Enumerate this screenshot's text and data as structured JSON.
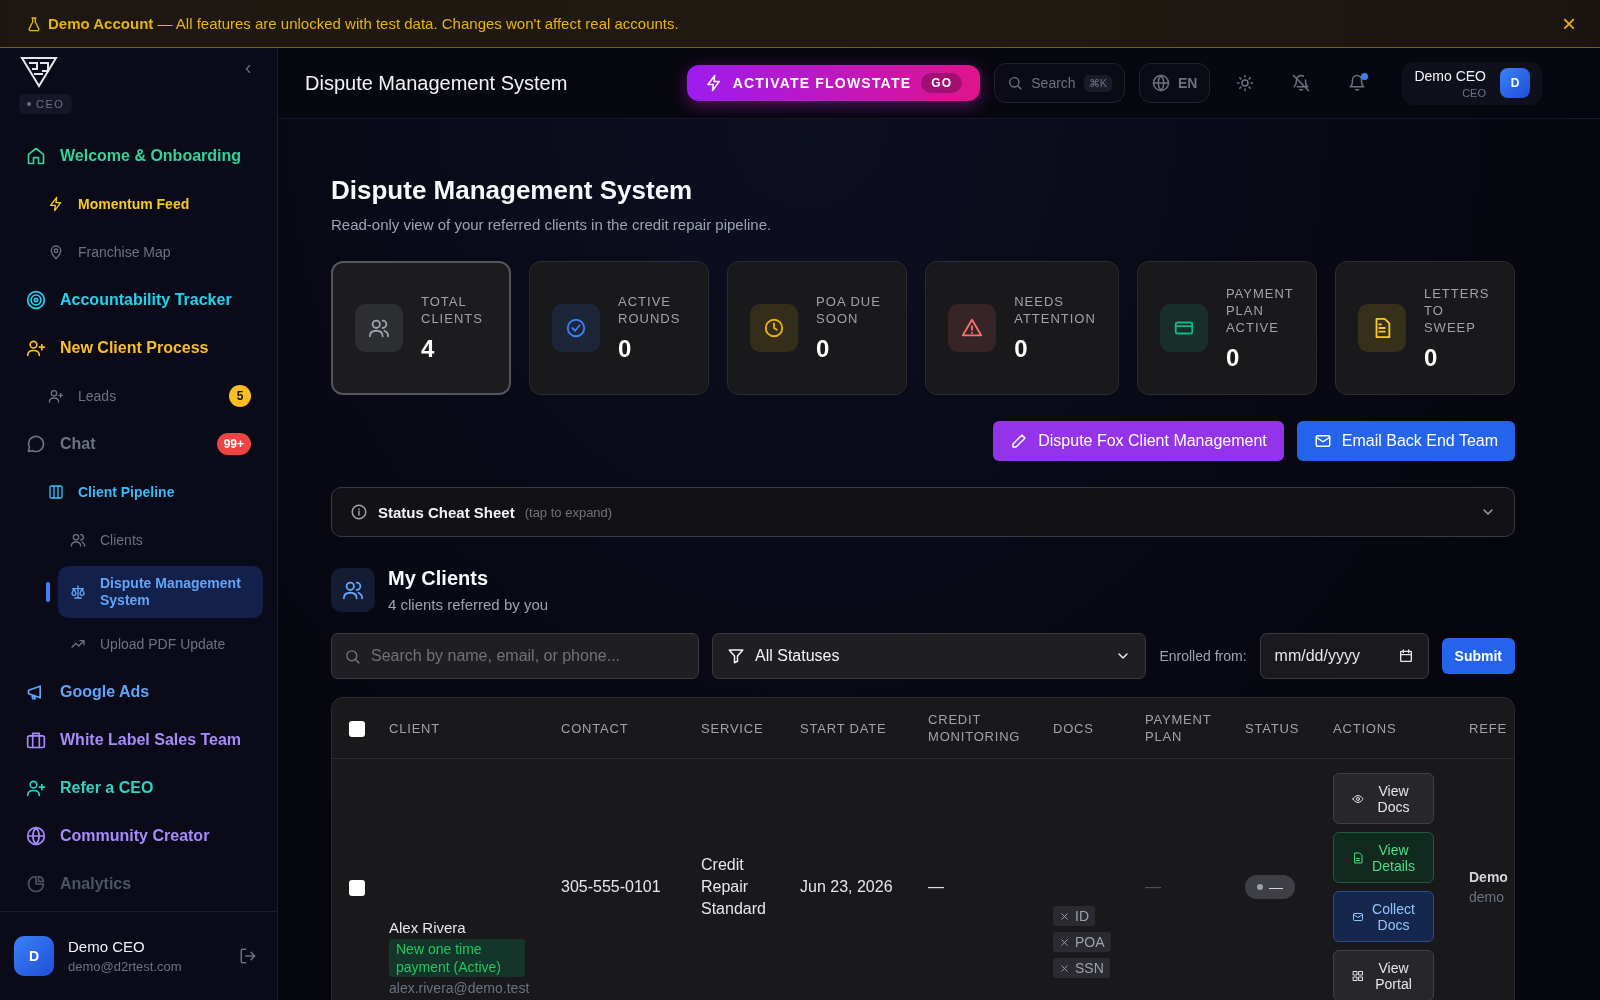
{
  "banner": {
    "text": "**Demo Account** — All features are unlocked with test data. Changes won't affect real accounts.",
    "close": "×"
  },
  "sidebar": {
    "role": "CEO",
    "items": [
      {
        "label": "Welcome & Onboarding",
        "color": "#34d399",
        "selected": false,
        "children": [
          {
            "label": "Momentum Feed",
            "color": "#facc15",
            "selected": false
          },
          {
            "label": "Franchise Map",
            "color": "#6b7280",
            "selected": false
          }
        ]
      },
      {
        "label": "Accountability Tracker",
        "color": "#22d3ee",
        "selected": false
      },
      {
        "label": "New Client Process",
        "color": "#fbbf24",
        "selected": false,
        "children": [
          {
            "label": "Leads",
            "color": "#6b7280",
            "selected": false,
            "badge": {
              "text": "5",
              "color": "#fbbf24"
            }
          }
        ]
      },
      {
        "label": "Chat",
        "color": "#6b7280",
        "selected": false,
        "badge": {
          "text": "99+",
          "color": "#ef4444"
        },
        "children": [
          {
            "label": "Client Pipeline",
            "color": "#38bdf8",
            "selected": false,
            "children": [
              {
                "label": "Clients",
                "color": "#6b7280",
                "selected": false
              },
              {
                "label": "Dispute Management System",
                "color": "#60a5fa",
                "selected": true
              },
              {
                "label": "Upload PDF Update",
                "color": "#6b7280",
                "selected": false
              }
            ]
          }
        ]
      },
      {
        "label": "Google Ads",
        "color": "#60a5fa",
        "selected": false
      },
      {
        "label": "White Label Sales Team",
        "color": "#a78bfa",
        "selected": false
      },
      {
        "label": "Refer a CEO",
        "color": "#2dd4bf",
        "selected": false
      },
      {
        "label": "Community Creator",
        "color": "#a78bfa",
        "selected": false
      },
      {
        "label": "Analytics",
        "color": "#4b5563",
        "selected": false
      }
    ],
    "user": {
      "avatar": "D",
      "name": "Demo CEO",
      "email": "demo@d2rtest.com"
    }
  },
  "topbar": {
    "title": "Dispute Management System",
    "flowstate": {
      "label": "ACTIVATE FLOWSTATE",
      "tag": "GO"
    },
    "search": {
      "placeholder": "Search",
      "shortcut": "⌘K"
    },
    "language": "EN",
    "user": {
      "name": "Demo CEO",
      "role": "CEO",
      "avatar": "D"
    }
  },
  "page": {
    "title": "Dispute Management System",
    "subtitle": "Read-only view of your referred clients in the credit repair pipeline."
  },
  "stats": [
    {
      "label": "TOTAL CLIENTS",
      "value": "4",
      "color": "#9ca3af",
      "selected": true
    },
    {
      "label": "ACTIVE ROUNDS",
      "value": "0",
      "color": "#3b82f6",
      "selected": false
    },
    {
      "label": "POA DUE SOON",
      "value": "0",
      "color": "#eab308",
      "selected": false
    },
    {
      "label": "NEEDS ATTENTION",
      "value": "0",
      "color": "#f87171",
      "selected": false
    },
    {
      "label": "PAYMENT PLAN ACTIVE",
      "value": "0",
      "color": "#10b981",
      "selected": false
    },
    {
      "label": "LETTERS TO SWEEP",
      "value": "0",
      "color": "#facc15",
      "selected": false
    }
  ],
  "actions": [
    {
      "label": "Dispute Fox Client Management",
      "color": "#9333ea"
    },
    {
      "label": "Email Back End Team",
      "color": "#2563eb"
    }
  ],
  "cheat_sheet": {
    "title": "Status Cheat Sheet",
    "hint": "(tap to expand)",
    "expanded": false
  },
  "clients": {
    "title": "My Clients",
    "subtitle": "4 clients referred by you",
    "filters": {
      "search": {
        "placeholder": "Search by name, email, or phone..."
      },
      "status": "All Statuses",
      "date_label": "Enrolled from:",
      "date": {
        "placeholder": "mm/dd/yyyy"
      },
      "submit": "Submit"
    },
    "table": {
      "select_all": false,
      "columns": [
        "CLIENT",
        "CONTACT",
        "SERVICE",
        "START DATE",
        "CREDIT MONITORING",
        "DOCS",
        "PAYMENT PLAN",
        "STATUS",
        "ACTIONS",
        "REFE"
      ],
      "rows": [
        {
          "checked": false,
          "name": "Alex Rivera",
          "plan": "New one time payment (Active)",
          "email": "alex.rivera@demo.test",
          "contact": "305-555-0101",
          "service": "Credit Repair Standard",
          "start_date": "Jun 23, 2026",
          "credit_monitoring": "—",
          "docs": [
            {
              "label": "ID",
              "received": false
            },
            {
              "label": "POA",
              "received": false
            },
            {
              "label": "SSN",
              "received": false
            }
          ],
          "payment_plan": "—",
          "status": "—",
          "actions": [
            {
              "label": "View Docs",
              "kind": "neutral"
            },
            {
              "label": "View Details",
              "kind": "success"
            },
            {
              "label": "Collect Docs",
              "kind": "primary"
            },
            {
              "label": "View Portal",
              "kind": "neutral"
            }
          ],
          "referrer": "Demo",
          "referrer_email": "demo"
        }
      ]
    }
  }
}
